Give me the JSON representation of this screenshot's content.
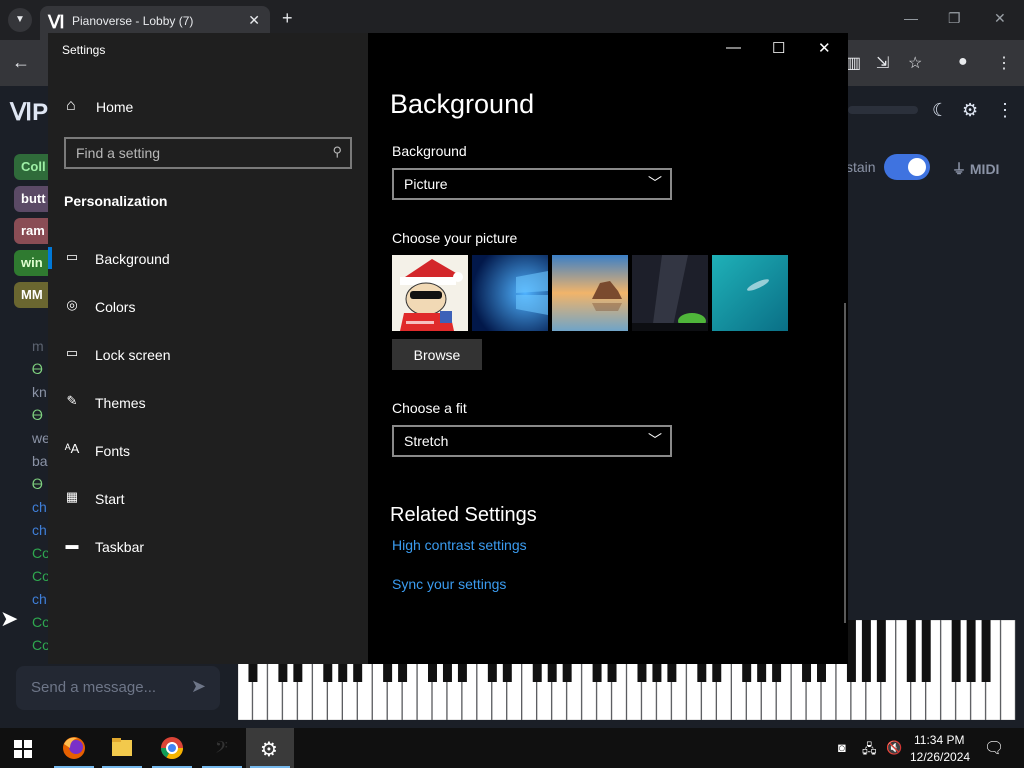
{
  "browser": {
    "tab_title": "Pianoverse - Lobby (7)",
    "tab_favicon": "Ⅵ",
    "new_tab": "+",
    "tab_close": "✕",
    "back": "←",
    "win_min": "—",
    "win_restore": "❐",
    "win_close": "✕"
  },
  "pianoverse": {
    "logo": "ⅥP",
    "chips": [
      {
        "label": "Coll",
        "bg": "#2f6b3a",
        "color": "#9ef0a6"
      },
      {
        "label": "butt",
        "bg": "#5b4a66",
        "color": "#ffffff"
      },
      {
        "label": "ram",
        "bg": "#8a4d55",
        "color": "#ffffff"
      },
      {
        "label": "win",
        "bg": "#2f7a30",
        "color": "#dfffd0"
      },
      {
        "label": "MM",
        "bg": "#6a6630",
        "color": "#ffffff"
      }
    ],
    "chat_lines": [
      {
        "text": "m",
        "color": "#5c6370"
      },
      {
        "text": "Ꮎ",
        "color": "#7fd17f"
      },
      {
        "text": "kn",
        "color": "#8b93a6"
      },
      {
        "text": "Ꮎ",
        "color": "#7fd17f"
      },
      {
        "text": "we",
        "color": "#8b93a6"
      },
      {
        "text": "ba",
        "color": "#8b93a6"
      },
      {
        "text": "Ꮎ",
        "color": "#7fd17f"
      },
      {
        "text": "ch",
        "color": "#3f7fd9"
      },
      {
        "text": "ch",
        "color": "#3f7fd9"
      },
      {
        "text": "Co",
        "color": "#2fa84f"
      },
      {
        "text": "Co",
        "color": "#2fa84f"
      },
      {
        "text": "ch",
        "color": "#3f7fd9"
      },
      {
        "text": "Co",
        "color": "#2fa84f"
      },
      {
        "text": "Co",
        "color": "#2fa84f"
      }
    ],
    "sustain_label": "stain",
    "sustain_on": true,
    "midi_label": "MIDI",
    "chat_placeholder": "Send a message..."
  },
  "settings": {
    "window_title": "Settings",
    "home": "Home",
    "search_placeholder": "Find a setting",
    "section": "Personalization",
    "nav_items": [
      {
        "label": "Background",
        "icon": "picture-icon",
        "glyph": "▭",
        "active": true
      },
      {
        "label": "Colors",
        "icon": "palette-icon",
        "glyph": "◎"
      },
      {
        "label": "Lock screen",
        "icon": "lock-screen-icon",
        "glyph": "▭"
      },
      {
        "label": "Themes",
        "icon": "themes-icon",
        "glyph": "✎"
      },
      {
        "label": "Fonts",
        "icon": "fonts-icon",
        "glyph": "ᴬA"
      },
      {
        "label": "Start",
        "icon": "start-icon",
        "glyph": "▦"
      },
      {
        "label": "Taskbar",
        "icon": "taskbar-icon",
        "glyph": "▬"
      }
    ],
    "heading": "Background",
    "background_label": "Background",
    "background_value": "Picture",
    "choose_picture_label": "Choose your picture",
    "browse_label": "Browse",
    "choose_fit_label": "Choose a fit",
    "fit_value": "Stretch",
    "related_heading": "Related Settings",
    "links": [
      "High contrast settings",
      "Sync your settings"
    ],
    "ctl_min": "—",
    "ctl_max": "☐",
    "ctl_close": "✕"
  },
  "taskbar": {
    "time": "11:34 PM",
    "date": "12/26/2024",
    "accent": "#76b9ed"
  }
}
